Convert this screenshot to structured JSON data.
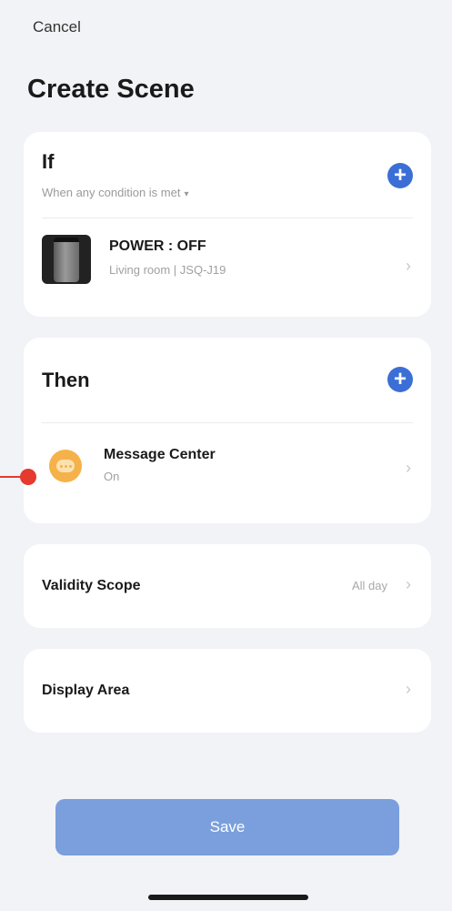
{
  "header": {
    "cancel_label": "Cancel",
    "title": "Create Scene"
  },
  "if_section": {
    "heading": "If",
    "condition_mode": "When any condition is met",
    "condition": {
      "title": "POWER : OFF",
      "subtitle": "Living room | JSQ-J19"
    }
  },
  "then_section": {
    "heading": "Then",
    "action": {
      "title": "Message Center",
      "subtitle": "On"
    }
  },
  "validity": {
    "label": "Validity Scope",
    "value": "All day"
  },
  "display": {
    "label": "Display Area"
  },
  "save_label": "Save",
  "icons": {
    "add": "plus-circle-icon",
    "chevron": "chevron-right-icon",
    "caret": "caret-down-icon",
    "message": "message-bubble-icon"
  },
  "colors": {
    "accent": "#3b6fd6",
    "save_button": "#7a9fdc",
    "message_icon": "#f5b24a",
    "annotation": "#e53a2e"
  }
}
